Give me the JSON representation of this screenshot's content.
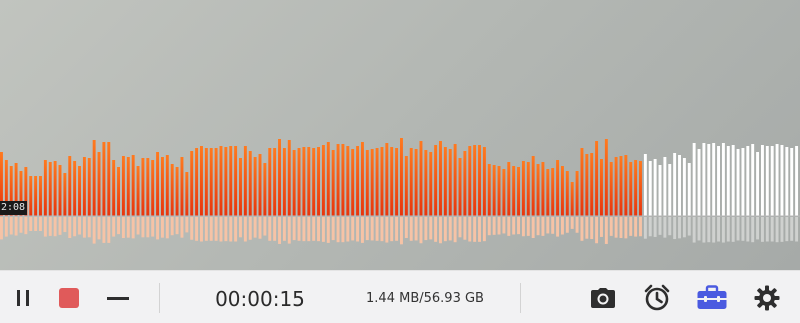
{
  "recording": {
    "waveform_time_marker": "2:08",
    "elapsed_time": "00:00:15",
    "file_size": "1.44 MB/56.93 GB",
    "progress_fraction": 0.804
  },
  "waveform": {
    "levels": [
      64,
      56,
      50,
      53,
      45,
      49,
      40,
      40,
      40,
      56,
      54,
      55,
      51,
      43,
      60,
      55,
      50,
      59,
      58,
      76,
      64,
      74,
      74,
      56,
      49,
      60,
      59,
      61,
      50,
      58,
      58,
      56,
      64,
      59,
      61,
      52,
      49,
      59,
      44,
      65,
      68,
      70,
      68,
      68,
      68,
      70,
      69,
      70,
      70,
      58,
      70,
      65,
      59,
      62,
      53,
      68,
      68,
      77,
      68,
      76,
      66,
      68,
      69,
      69,
      68,
      69,
      71,
      74,
      66,
      72,
      72,
      70,
      67,
      70,
      74,
      66,
      67,
      68,
      69,
      73,
      69,
      68,
      78,
      60,
      68,
      67,
      75,
      66,
      64,
      71,
      75,
      69,
      67,
      72,
      58,
      65,
      70,
      71,
      71,
      69,
      52,
      51,
      50,
      47,
      54,
      50,
      49,
      55,
      54,
      60,
      52,
      54,
      47,
      48,
      56,
      50,
      45,
      34,
      45,
      68,
      62,
      63,
      75,
      57,
      77,
      54,
      59,
      60,
      61,
      54,
      56,
      55,
      62,
      55,
      57,
      51,
      59,
      52,
      63,
      61,
      58,
      53,
      73,
      67,
      73,
      72,
      73,
      70,
      73,
      70,
      71,
      67,
      68,
      70,
      72,
      64,
      71,
      70,
      70,
      72,
      71,
      69,
      68,
      70
    ],
    "played_color_top": "#ff7a1f",
    "played_color_bottom": "#e8340c",
    "played_reflection_color": "#f6c3a6",
    "unplayed_color": "#ffffff",
    "unplayed_reflection_color": "#cfd1cf"
  },
  "controls": {
    "pause_icon": "pause-icon",
    "stop_icon": "stop-icon",
    "minimize_icon": "minimize-icon",
    "camera_icon": "camera-icon",
    "schedule_icon": "timer-clock-icon",
    "toolbox_icon": "toolbox-icon",
    "settings_icon": "gear-icon"
  },
  "colors": {
    "stop": "#e05a5a",
    "toolbox": "#4a5ae0",
    "icon": "#2e2e2e"
  }
}
